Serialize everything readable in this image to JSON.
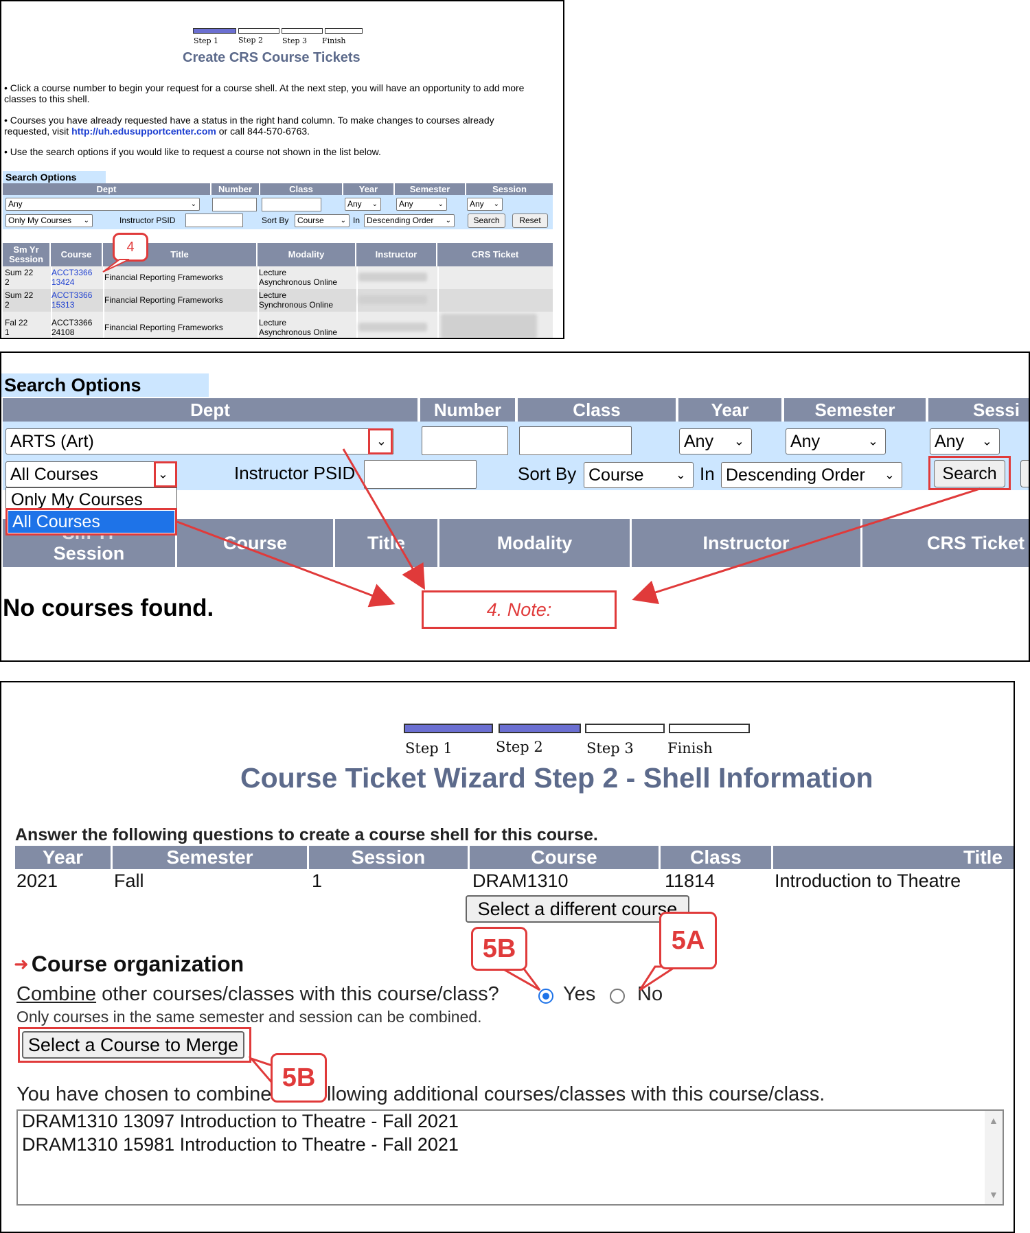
{
  "panel1": {
    "steps": [
      "Step 1",
      "Step 2",
      "Step 3",
      "Finish"
    ],
    "title": "Create CRS Course Tickets",
    "bullet1": "•   Click a course number to begin your request for a course shell. At the next step, you will have an opportunity to add more classes to this shell.",
    "bullet2_pre": "•   Courses you have already requested have a status in the right hand column. To make changes to courses already requested, visit ",
    "bullet2_link": "http://uh.edusupportcenter.com",
    "bullet2_post": " or call 844-570-6763.",
    "bullet3": "•   Use the search options if you would like to request a course not shown in the list below.",
    "search_options_label": "Search Options",
    "filter_headers": [
      "Dept",
      "Number",
      "Class",
      "Year",
      "Semester",
      "Session"
    ],
    "dept_value": "Any",
    "year_value": "Any",
    "semester_value": "Any",
    "session_value": "Any",
    "scope_value": "Only My Courses",
    "instructor_label": "Instructor PSID",
    "sort_by_label": "Sort By",
    "sort_value": "Course",
    "in_label": "In",
    "order_value": "Descending Order",
    "search_button": "Search",
    "reset_button": "Reset",
    "table_headers": [
      "Sm Yr Session",
      "Course",
      "Title",
      "Modality",
      "Instructor",
      "CRS Ticket"
    ],
    "rows": [
      {
        "term": "Sum 22",
        "session": "2",
        "course": "ACCT3366",
        "class": "13424",
        "title": "Financial Reporting Frameworks",
        "modality1": "Lecture",
        "modality2": "Asynchronous Online"
      },
      {
        "term": "Sum 22",
        "session": "2",
        "course": "ACCT3366",
        "class": "15313",
        "title": "Financial Reporting Frameworks",
        "modality1": "Lecture",
        "modality2": "Synchronous Online"
      },
      {
        "term": "Fal 22",
        "session": "1",
        "course": "ACCT3366",
        "class": "24108",
        "title": "Financial Reporting Frameworks",
        "modality1": "Lecture",
        "modality2": "Asynchronous Online"
      }
    ],
    "callout": "4"
  },
  "panel2": {
    "search_options_label": "Search Options",
    "filter_headers": [
      "Dept",
      "Number",
      "Class",
      "Year",
      "Semester",
      "Sessi"
    ],
    "dept_value": "ARTS (Art)",
    "year_value": "Any",
    "semester_value": "Any",
    "session_value": "Any",
    "scope_value": "All Courses",
    "dropdown_options": [
      "Only My Courses",
      "All Courses"
    ],
    "instructor_label": "Instructor PSID",
    "sort_by_label": "Sort By",
    "sort_value": "Course",
    "in_label": "In",
    "order_value": "Descending Order",
    "search_button": "Search",
    "table_headers": [
      "Session",
      "Course",
      "Title",
      "Modality",
      "Instructor",
      "CRS Ticket"
    ],
    "table_header_partial": "Sm Yr",
    "no_results": "No courses found.",
    "note": "4. Note:"
  },
  "panel3": {
    "steps": [
      "Step 1",
      "Step 2",
      "Step 3",
      "Finish"
    ],
    "title": "Course Ticket Wizard Step 2 - Shell Information",
    "instruction": "Answer the following questions to create a course shell for this course.",
    "headers": [
      "Year",
      "Semester",
      "Session",
      "Course",
      "Class",
      "Title"
    ],
    "row": {
      "year": "2021",
      "semester": "Fall",
      "session": "1",
      "course": "DRAM1310",
      "class": "11814",
      "title": "Introduction to Theatre"
    },
    "select_different": "Select a different course",
    "section_title": "Course organization",
    "combine_word": "Combine",
    "combine_rest": " other courses/classes with this course/class?",
    "yes_label": "Yes",
    "no_label": "No",
    "note": "Only courses in the same semester and session can be combined.",
    "merge_button": "Select a Course to Merge",
    "chosen_text": "You have chosen to combine the following additional courses/classes with this course/class.",
    "chosen_items": [
      "DRAM1310 13097 Introduction to Theatre - Fall 2021",
      "DRAM1310 15981 Introduction to Theatre - Fall 2021"
    ],
    "callout_5a": "5A",
    "callout_5b": "5B"
  },
  "colors": {
    "header": "#828ca5",
    "light_blue": "#cce6ff",
    "step_fill": "#6b6fd1",
    "callout_red": "#e03a3a",
    "link": "#1c3ed1"
  }
}
